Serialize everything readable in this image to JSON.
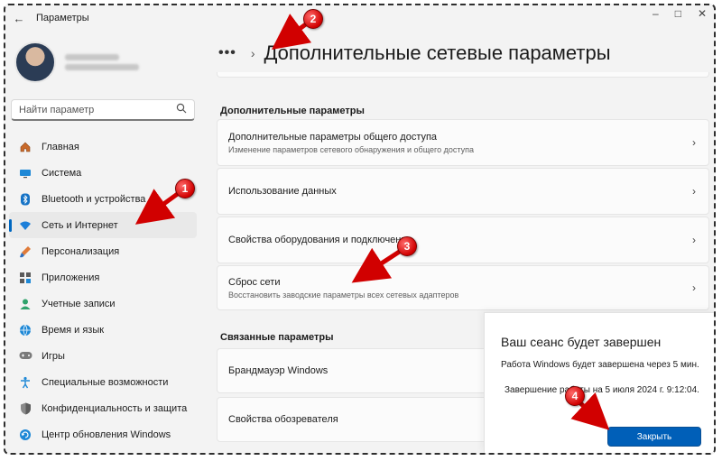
{
  "window": {
    "title": "Параметры",
    "controls": [
      "minimize",
      "maximize",
      "close"
    ]
  },
  "sidebar": {
    "search_placeholder": "Найти параметр",
    "items": [
      {
        "label": "Главная",
        "icon": "home-icon",
        "active": false
      },
      {
        "label": "Система",
        "icon": "monitor-icon",
        "active": false
      },
      {
        "label": "Bluetooth и устройства",
        "icon": "bluetooth-icon",
        "active": false
      },
      {
        "label": "Сеть и Интернет",
        "icon": "wifi-icon",
        "active": true
      },
      {
        "label": "Персонализация",
        "icon": "brush-icon",
        "active": false
      },
      {
        "label": "Приложения",
        "icon": "apps-icon",
        "active": false
      },
      {
        "label": "Учетные записи",
        "icon": "account-icon",
        "active": false
      },
      {
        "label": "Время и язык",
        "icon": "globe-clock-icon",
        "active": false
      },
      {
        "label": "Игры",
        "icon": "gamepad-icon",
        "active": false
      },
      {
        "label": "Специальные возможности",
        "icon": "accessibility-icon",
        "active": false
      },
      {
        "label": "Конфиденциальность и защита",
        "icon": "shield-icon",
        "active": false
      },
      {
        "label": "Центр обновления Windows",
        "icon": "update-icon",
        "active": false
      }
    ]
  },
  "main": {
    "breadcrumb_dots": "•••",
    "breadcrumb_chevron": "›",
    "page_title": "Дополнительные сетевые параметры",
    "section1_header": "Дополнительные параметры",
    "cards1": [
      {
        "title": "Дополнительные параметры общего доступа",
        "subtitle": "Изменение параметров сетевого обнаружения и общего доступа"
      },
      {
        "title": "Использование данных",
        "subtitle": ""
      },
      {
        "title": "Свойства оборудования и подключения",
        "subtitle": ""
      },
      {
        "title": "Сброс сети",
        "subtitle": "Восстановить заводские параметры всех сетевых адаптеров"
      }
    ],
    "section2_header": "Связанные параметры",
    "cards2": [
      {
        "title": "Брандмауэр Windows"
      },
      {
        "title": "Свойства обозревателя"
      }
    ],
    "chevron": "›"
  },
  "dialog": {
    "heading": "Ваш сеанс будет завершен",
    "line1": "Работа Windows будет завершена через 5 мин.",
    "line2": "Завершение работы на 5 июля 2024 г. 9:12:04.",
    "button": "Закрыть"
  },
  "annotations": [
    {
      "number": "1",
      "target": "Сеть и Интернет"
    },
    {
      "number": "2",
      "target": "Дополнительные сетевые параметры"
    },
    {
      "number": "3",
      "target": "Сброс сети"
    },
    {
      "number": "4",
      "target": "Закрыть"
    }
  ],
  "colors": {
    "accent": "#005fb8",
    "annotation": "#d10000",
    "background": "#f3f3f3",
    "card": "#fbfbfb"
  }
}
